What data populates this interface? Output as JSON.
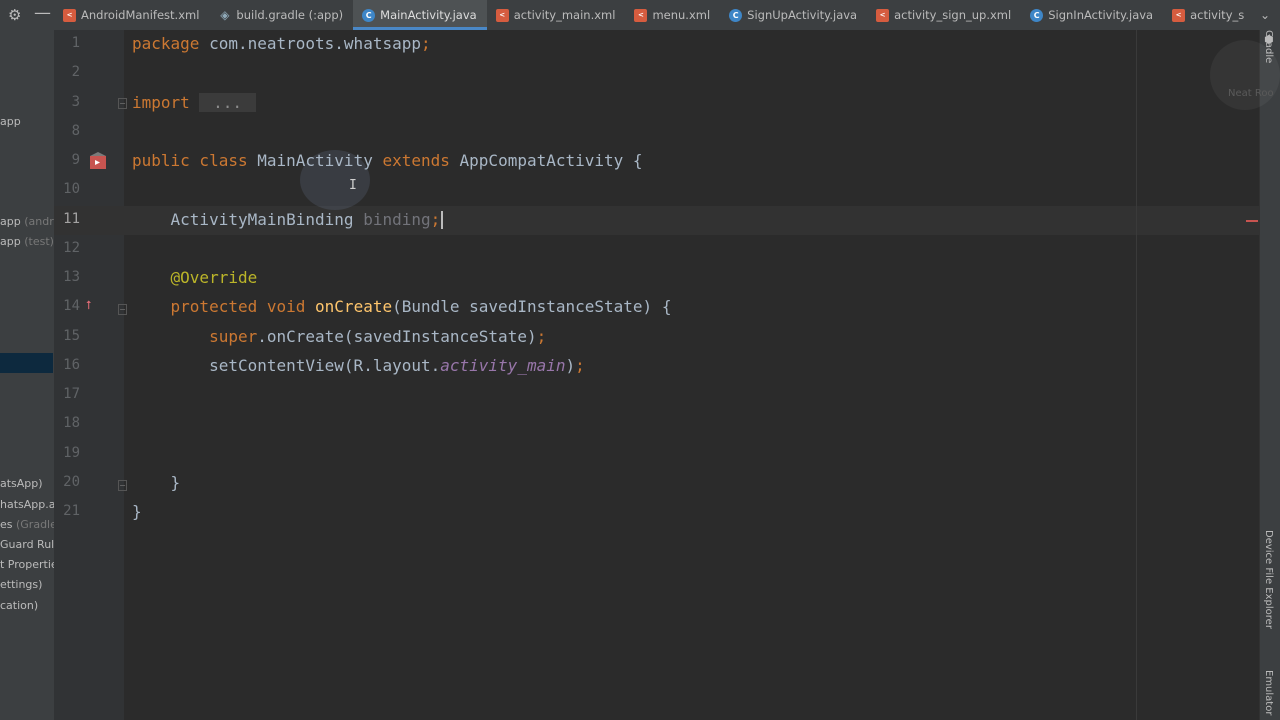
{
  "project_panel": {
    "items": [
      {
        "text": "app",
        "muted": ""
      },
      {
        "text": "app",
        "muted": " (andro"
      },
      {
        "text": "app",
        "muted": " (test)"
      },
      {
        "text": "atsApp)",
        "muted": ""
      },
      {
        "text": "hatsApp.ap",
        "muted": ""
      },
      {
        "text": "es",
        "muted": " (Gradle"
      },
      {
        "text": "Guard Rules",
        "muted": ""
      },
      {
        "text": "t Propertie",
        "muted": ""
      },
      {
        "text": "ettings)",
        "muted": ""
      },
      {
        "text": "cation)",
        "muted": ""
      }
    ]
  },
  "tabs": [
    {
      "label": "AndroidManifest.xml",
      "icon": "xml-file-icon",
      "active": false
    },
    {
      "label": "build.gradle (:app)",
      "icon": "gradle-icon",
      "active": false
    },
    {
      "label": "MainActivity.java",
      "icon": "java-class-icon",
      "active": true
    },
    {
      "label": "activity_main.xml",
      "icon": "xml-file-icon",
      "active": false
    },
    {
      "label": "menu.xml",
      "icon": "xml-file-icon",
      "active": false
    },
    {
      "label": "SignUpActivity.java",
      "icon": "java-class-icon",
      "active": false
    },
    {
      "label": "activity_sign_up.xml",
      "icon": "xml-file-icon",
      "active": false
    },
    {
      "label": "SignInActivity.java",
      "icon": "java-class-icon",
      "active": false
    },
    {
      "label": "activity_s",
      "icon": "xml-file-icon",
      "active": false
    }
  ],
  "editor": {
    "current_line": 11,
    "lines": [
      {
        "n": "1",
        "tokens": [
          [
            "kw",
            "package "
          ],
          [
            "",
            "com.neatroots.whatsapp"
          ],
          [
            "kw",
            ";"
          ]
        ]
      },
      {
        "n": "2",
        "tokens": []
      },
      {
        "n": "3",
        "tokens": [
          [
            "kw",
            "import "
          ],
          [
            "fold",
            " ... "
          ]
        ]
      },
      {
        "n": "8",
        "tokens": []
      },
      {
        "n": "9",
        "tokens": [
          [
            "kw",
            "public class "
          ],
          [
            "",
            "MainActivity "
          ],
          [
            "kw",
            "extends "
          ],
          [
            "",
            "AppCompatActivity {"
          ]
        ]
      },
      {
        "n": "10",
        "tokens": []
      },
      {
        "n": "11",
        "tokens": [
          [
            "",
            "    ActivityMainBinding "
          ],
          [
            "unused",
            "binding"
          ],
          [
            "kw",
            ";"
          ],
          [
            "caret",
            ""
          ]
        ]
      },
      {
        "n": "12",
        "tokens": []
      },
      {
        "n": "13",
        "tokens": [
          [
            "ann",
            "    @Override"
          ]
        ]
      },
      {
        "n": "14",
        "tokens": [
          [
            "kw",
            "    protected void "
          ],
          [
            "fn",
            "onCreate"
          ],
          [
            "",
            "(Bundle savedInstanceState) {"
          ]
        ]
      },
      {
        "n": "15",
        "tokens": [
          [
            "kw",
            "        super"
          ],
          [
            "",
            ".onCreate(savedInstanceState)"
          ],
          [
            "kw",
            ";"
          ]
        ]
      },
      {
        "n": "16",
        "tokens": [
          [
            "",
            "        setContentView(R.layout."
          ],
          [
            "fld",
            "activity_main"
          ],
          [
            "",
            ")"
          ],
          [
            "kw",
            ";"
          ]
        ]
      },
      {
        "n": "17",
        "tokens": []
      },
      {
        "n": "18",
        "tokens": []
      },
      {
        "n": "19",
        "tokens": []
      },
      {
        "n": "20",
        "tokens": [
          [
            "",
            "    }"
          ]
        ]
      },
      {
        "n": "21",
        "tokens": [
          [
            "",
            "}"
          ]
        ]
      }
    ]
  },
  "right_strip": {
    "gradle_label": "Gradle",
    "device_explorer_label": "Device File Explorer",
    "emulator_label": "Emulator"
  },
  "watermark_text": "Neat Roo"
}
